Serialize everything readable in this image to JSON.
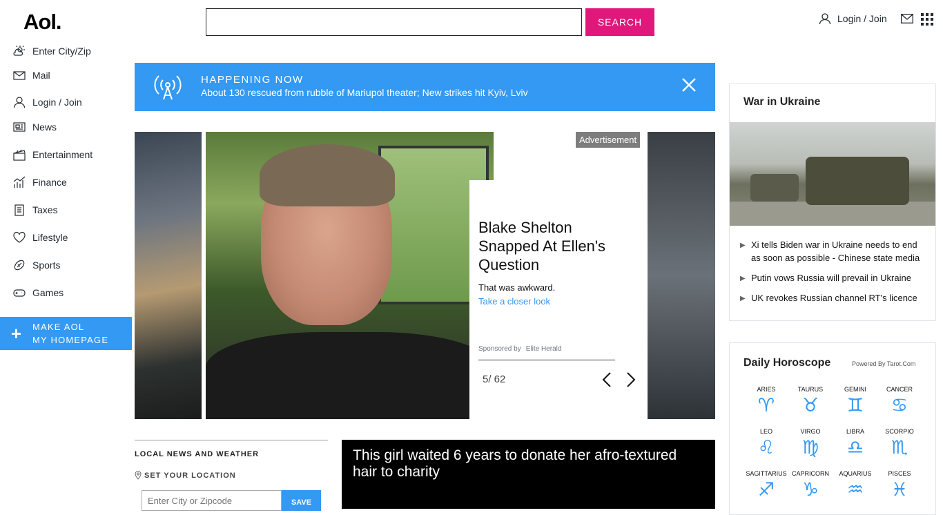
{
  "header": {
    "logo": "Aol.",
    "search_placeholder": "",
    "search_button": "SEARCH",
    "login": "Login / Join"
  },
  "sidebar": {
    "items": [
      {
        "label": "Enter City/Zip",
        "icon": "weather-icon"
      },
      {
        "label": "Mail",
        "icon": "mail-icon"
      },
      {
        "label": "Login / Join",
        "icon": "user-icon"
      },
      {
        "label": "News",
        "icon": "news-icon"
      },
      {
        "label": "Entertainment",
        "icon": "clapperboard-icon"
      },
      {
        "label": "Finance",
        "icon": "chart-icon"
      },
      {
        "label": "Taxes",
        "icon": "document-icon"
      },
      {
        "label": "Lifestyle",
        "icon": "heart-icon"
      },
      {
        "label": "Sports",
        "icon": "football-icon"
      },
      {
        "label": "Games",
        "icon": "gamepad-icon"
      }
    ],
    "make_homepage_line1": "MAKE AOL",
    "make_homepage_line2": "MY HOMEPAGE"
  },
  "banner": {
    "title": "HAPPENING NOW",
    "text": "About 130 rescued from rubble of Mariupol theater; New strikes hit Kyiv, Lviv"
  },
  "slideshow": {
    "ad_tag": "Advertisement",
    "title": "Blake Shelton Snapped At Ellen's Question",
    "subtitle": "That was awkward.",
    "link": "Take a closer look",
    "sponsored_label": "Sponsored by",
    "sponsor": "Elite Herald",
    "counter": "5/ 62"
  },
  "local": {
    "title": "LOCAL NEWS AND WEATHER",
    "set_location": "SET YOUR LOCATION",
    "input_placeholder": "Enter City or Zipcode",
    "save": "SAVE"
  },
  "video": {
    "title": "This girl waited 6 years to donate her afro-textured hair to charity"
  },
  "ukraine": {
    "title": "War in Ukraine",
    "items": [
      "Xi tells Biden war in Ukraine needs to end as soon as possible - Chinese state media",
      "Putin vows Russia will prevail in Ukraine",
      "UK revokes Russian channel RT's licence"
    ]
  },
  "horoscope": {
    "title": "Daily Horoscope",
    "powered": "Powered By Tarot.Com",
    "signs": [
      {
        "name": "ARIES",
        "symbol": "♈"
      },
      {
        "name": "TAURUS",
        "symbol": "♉"
      },
      {
        "name": "GEMINI",
        "symbol": "♊"
      },
      {
        "name": "CANCER",
        "symbol": "♋"
      },
      {
        "name": "LEO",
        "symbol": "♌"
      },
      {
        "name": "VIRGO",
        "symbol": "♍"
      },
      {
        "name": "LIBRA",
        "symbol": "♎"
      },
      {
        "name": "SCORPIO",
        "symbol": "♏"
      },
      {
        "name": "SAGITTARIUS",
        "symbol": "♐"
      },
      {
        "name": "CAPRICORN",
        "symbol": "♑"
      },
      {
        "name": "AQUARIUS",
        "symbol": "♒"
      },
      {
        "name": "PISCES",
        "symbol": "♓"
      }
    ]
  },
  "colors": {
    "accent_blue": "#3399f3",
    "search_pink": "#e0187c"
  }
}
